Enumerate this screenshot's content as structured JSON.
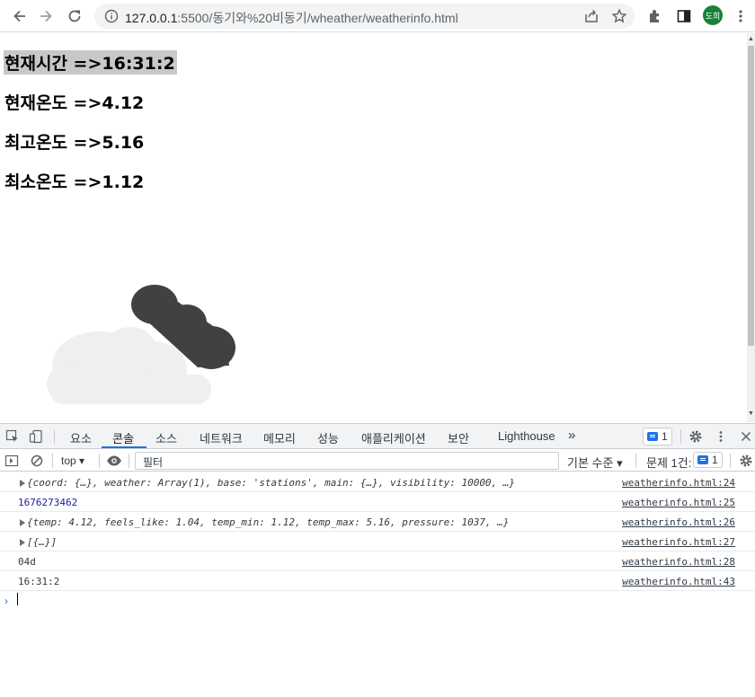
{
  "browser": {
    "url_host": "127.0.0.1",
    "url_rest": ":5500/동기와%20비동기/wheather/weatherinfo.html",
    "profile_initials": "도희"
  },
  "page": {
    "lines": [
      {
        "label": "현재시간 =>16:31:2"
      },
      {
        "label": "현재온도 =>4.12"
      },
      {
        "label": "최고온도 =>5.16"
      },
      {
        "label": "최소온도 =>1.12"
      }
    ],
    "weather_icon": "broken-clouds-icon"
  },
  "devtools": {
    "tabs": [
      "요소",
      "콘솔",
      "소스",
      "네트워크",
      "메모리",
      "성능",
      "애플리케이션",
      "보안",
      "Lighthouse"
    ],
    "active_tab": "콘솔",
    "more_tabs": "»",
    "issues_count": "1",
    "context": "top",
    "filter_placeholder": "필터",
    "levels_label": "기본 수준",
    "issues_label": "문제 1건:",
    "issues_badge": "1",
    "rows": [
      {
        "text": "{coord: {…}, weather: Array(1), base: 'stations', main: {…}, visibility: 10000, …}",
        "source": "weatherinfo.html:24",
        "expandable": true
      },
      {
        "text": "1676273462",
        "source": "weatherinfo.html:25",
        "expandable": false
      },
      {
        "text": "{temp: 4.12, feels_like: 1.04, temp_min: 1.12, temp_max: 5.16, pressure: 1037, …}",
        "source": "weatherinfo.html:26",
        "expandable": true
      },
      {
        "text": "[{…}]",
        "source": "weatherinfo.html:27",
        "expandable": true
      },
      {
        "text": "04d",
        "source": "weatherinfo.html:28",
        "expandable": false
      },
      {
        "text": "16:31:2",
        "source": "weatherinfo.html:43",
        "expandable": false
      }
    ],
    "prompt": "›"
  }
}
